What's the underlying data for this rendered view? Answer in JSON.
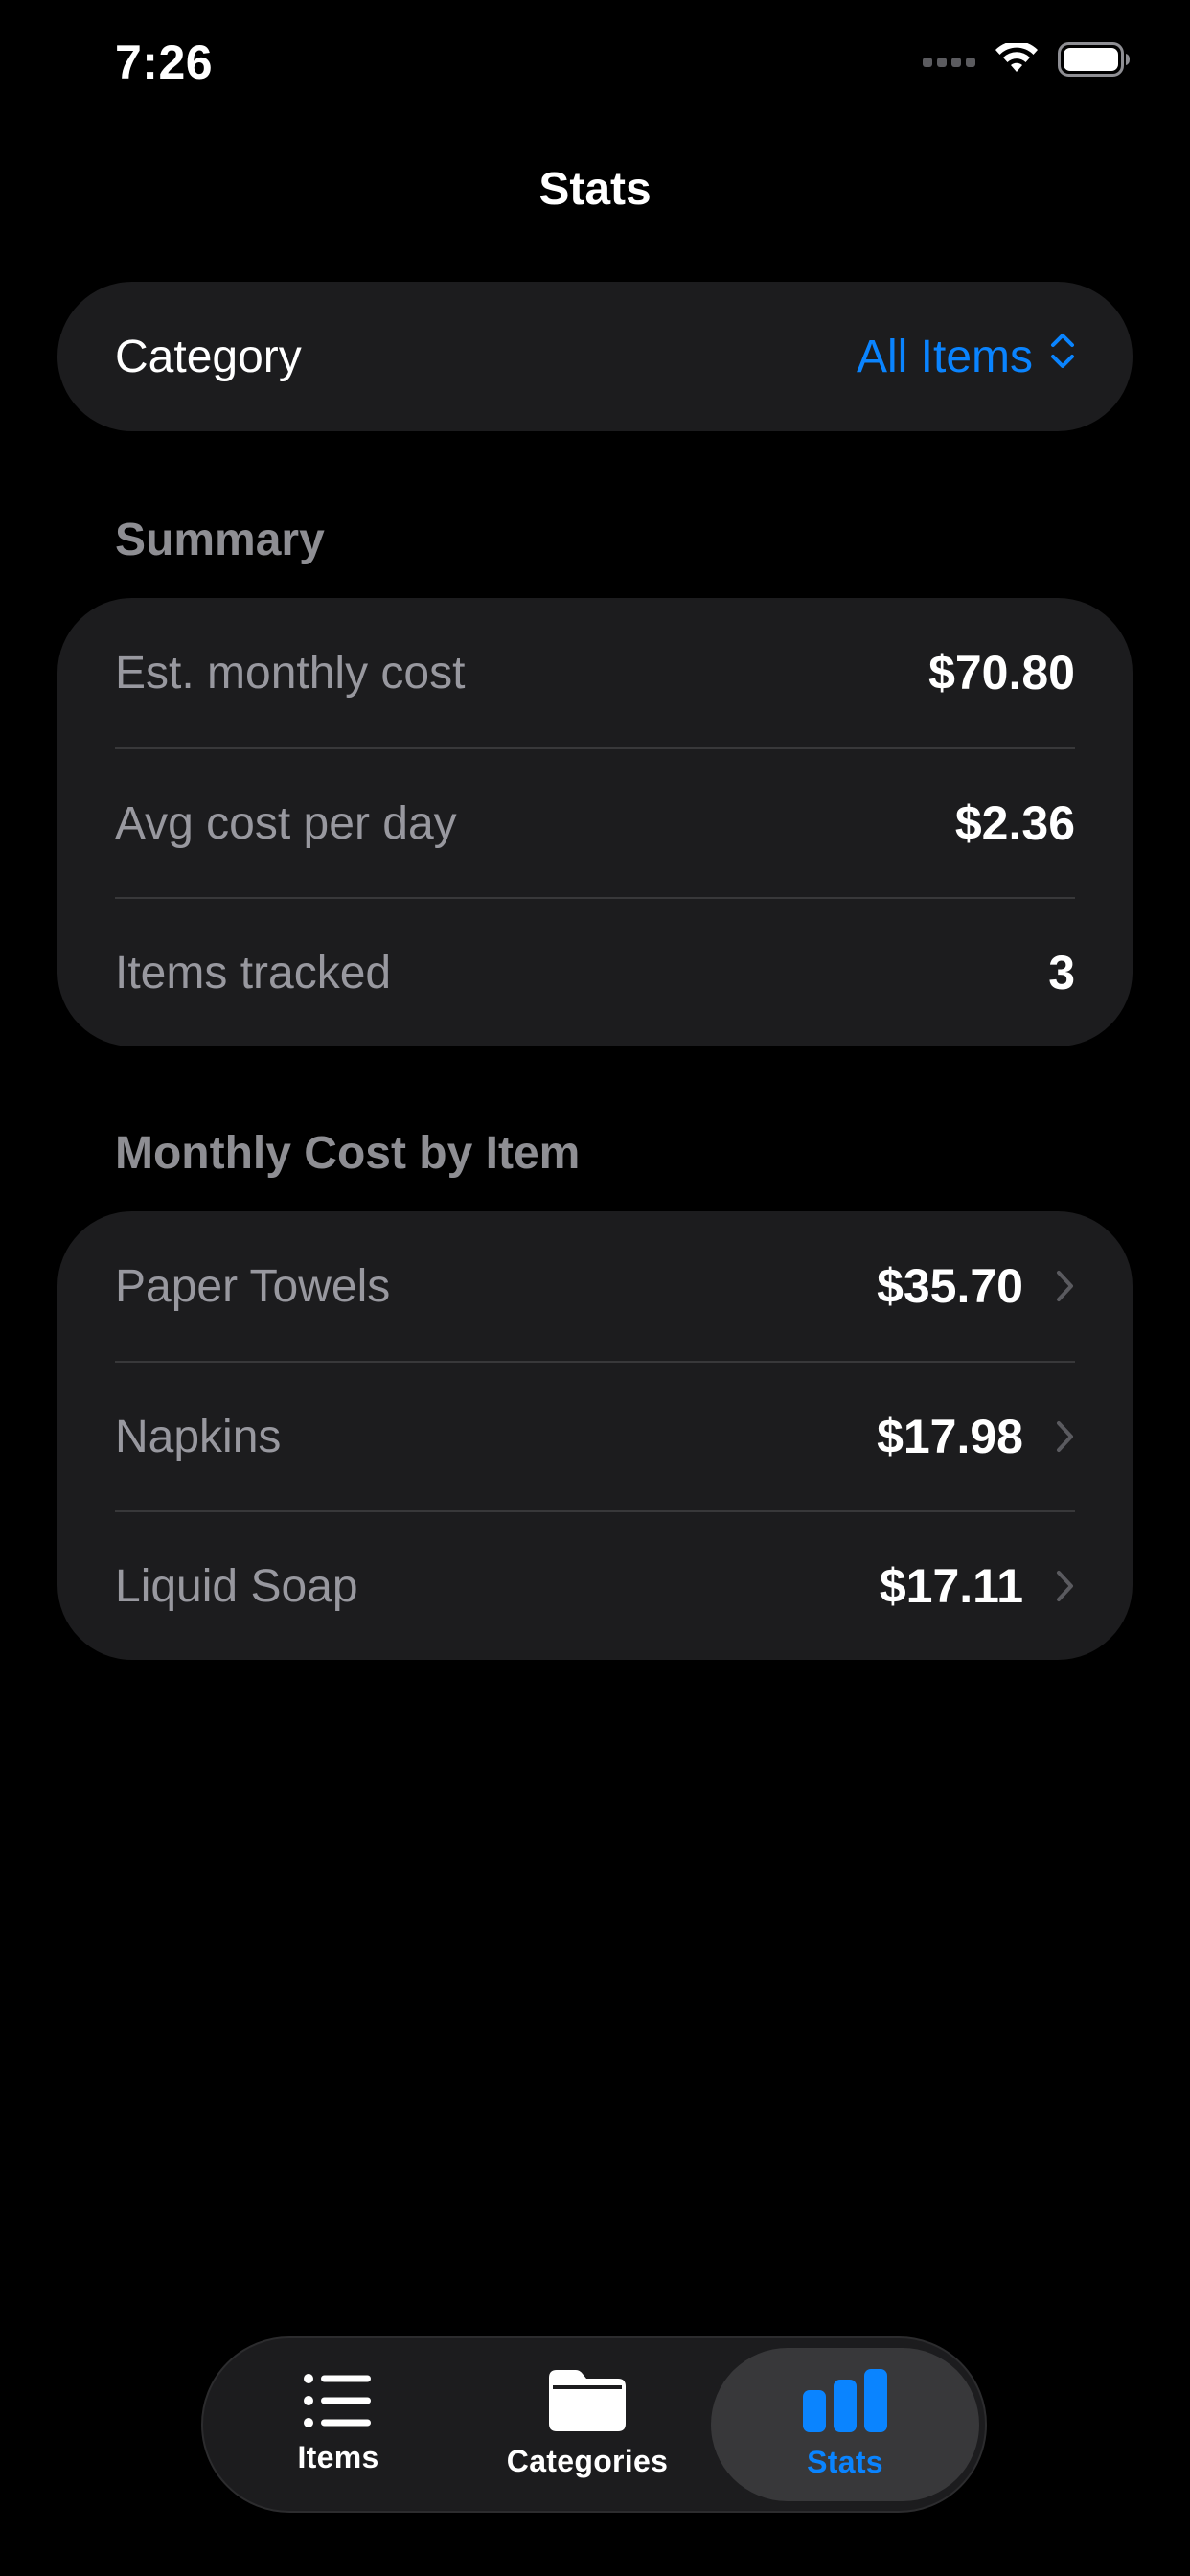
{
  "status_bar": {
    "time": "7:26"
  },
  "nav": {
    "title": "Stats"
  },
  "category": {
    "label": "Category",
    "selected": "All Items"
  },
  "summary": {
    "header": "Summary",
    "rows": [
      {
        "label": "Est. monthly cost",
        "value": "$70.80"
      },
      {
        "label": "Avg cost per day",
        "value": "$2.36"
      },
      {
        "label": "Items tracked",
        "value": "3"
      }
    ]
  },
  "monthly_cost": {
    "header": "Monthly Cost by Item",
    "rows": [
      {
        "label": "Paper Towels",
        "value": "$35.70"
      },
      {
        "label": "Napkins",
        "value": "$17.98"
      },
      {
        "label": "Liquid Soap",
        "value": "$17.11"
      }
    ]
  },
  "tab_bar": {
    "tabs": [
      {
        "label": "Items",
        "icon": "list-icon",
        "selected": false
      },
      {
        "label": "Categories",
        "icon": "folder-icon",
        "selected": false
      },
      {
        "label": "Stats",
        "icon": "bar-chart-icon",
        "selected": true
      }
    ]
  },
  "colors": {
    "background": "#000000",
    "card": "#1c1c1e",
    "accent": "#0a84ff",
    "secondary_text": "#98989f",
    "separator": "#38383a"
  }
}
